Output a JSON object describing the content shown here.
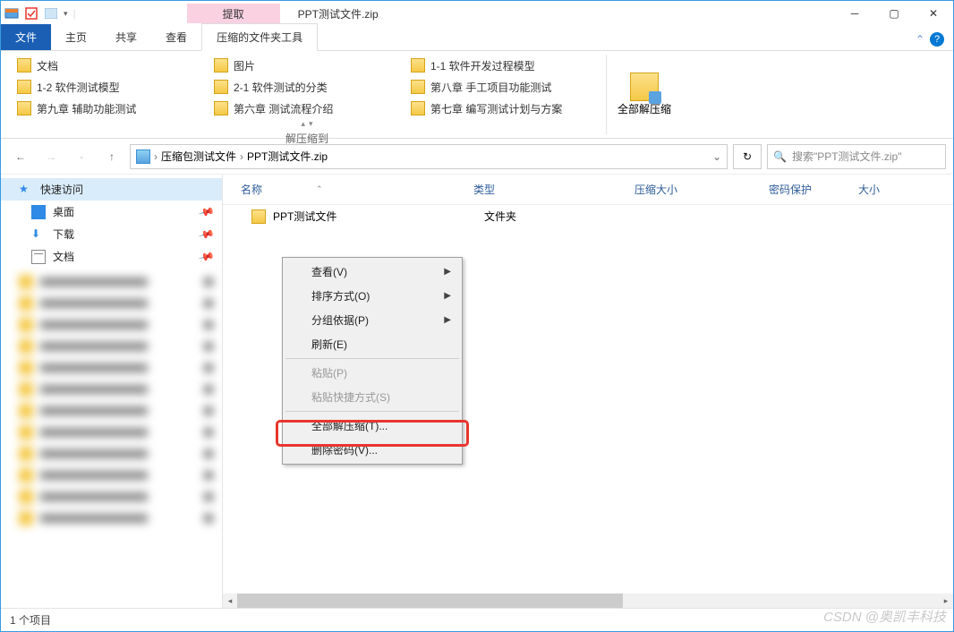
{
  "titlebar": {
    "contextual_label": "提取",
    "window_title": "PPT测试文件.zip"
  },
  "tabs": {
    "file": "文件",
    "home": "主页",
    "share": "共享",
    "view": "查看",
    "compressed": "压缩的文件夹工具"
  },
  "ribbon": {
    "items": [
      "文档",
      "图片",
      "1-1 软件开发过程模型",
      "1-2 软件测试模型",
      "2-1 软件测试的分类",
      "第八章 手工项目功能测试",
      "第九章 辅助功能测试",
      "第六章 测试流程介绍",
      "第七章 编写测试计划与方案"
    ],
    "group_label": "解压缩到",
    "extract_all": "全部解压缩"
  },
  "breadcrumb": {
    "part1": "压缩包测试文件",
    "part2": "PPT测试文件.zip"
  },
  "search": {
    "placeholder": "搜索\"PPT测试文件.zip\""
  },
  "sidebar": {
    "quick_access": "快速访问",
    "desktop": "桌面",
    "downloads": "下载",
    "documents": "文档"
  },
  "columns": {
    "name": "名称",
    "type": "类型",
    "compressed_size": "压缩大小",
    "password_protected": "密码保护",
    "size": "大小"
  },
  "file_list": {
    "item0": {
      "name": "PPT测试文件",
      "type": "文件夹"
    }
  },
  "context_menu": {
    "view": "查看(V)",
    "sort": "排序方式(O)",
    "group": "分组依据(P)",
    "refresh": "刷新(E)",
    "paste": "粘贴(P)",
    "paste_shortcut": "粘贴快捷方式(S)",
    "extract_all": "全部解压缩(T)...",
    "delete_password": "删除密码(V)..."
  },
  "statusbar": {
    "item_count": "1 个项目"
  },
  "watermark": "CSDN @奥凯丰科技"
}
